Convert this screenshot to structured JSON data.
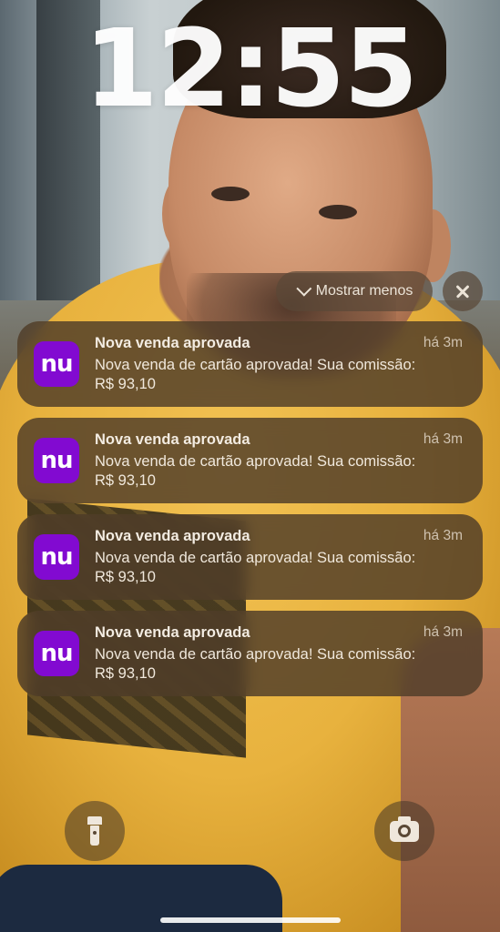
{
  "lockscreen": {
    "time": "12:55"
  },
  "controls": {
    "show_less_label": "Mostrar menos",
    "clear_icon": "close-icon"
  },
  "notifications": [
    {
      "app": "Nubank",
      "icon_text": "nu",
      "icon_color": "#820ad1",
      "title": "Nova venda aprovada",
      "time": "há 3m",
      "body": "Nova venda de cartão aprovada!  Sua comissão:\nR$ 93,10"
    },
    {
      "app": "Nubank",
      "icon_text": "nu",
      "icon_color": "#820ad1",
      "title": "Nova venda aprovada",
      "time": "há 3m",
      "body": "Nova venda de cartão aprovada!  Sua comissão:\nR$ 93,10"
    },
    {
      "app": "Nubank",
      "icon_text": "nu",
      "icon_color": "#820ad1",
      "title": "Nova venda aprovada",
      "time": "há 3m",
      "body": "Nova venda de cartão aprovada!  Sua comissão:\nR$ 93,10"
    },
    {
      "app": "Nubank",
      "icon_text": "nu",
      "icon_color": "#820ad1",
      "title": "Nova venda aprovada",
      "time": "há 3m",
      "body": "Nova venda de cartão aprovada!  Sua comissão:\nR$ 93,10"
    }
  ],
  "quick_actions": {
    "left_icon": "flashlight-icon",
    "right_icon": "camera-icon"
  }
}
